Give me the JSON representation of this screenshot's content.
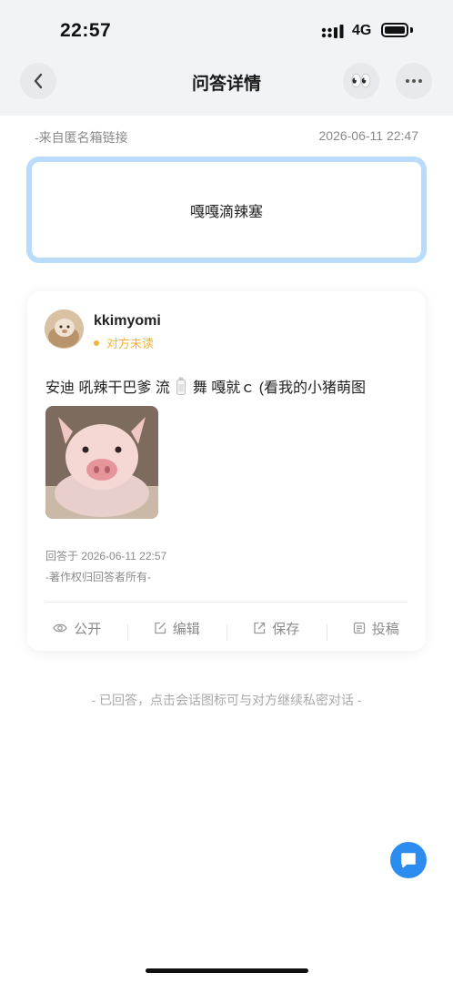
{
  "status_bar": {
    "time": "22:57",
    "network": "4G"
  },
  "header": {
    "title": "问答详情",
    "eyes_emoji": "👀"
  },
  "question": {
    "source": "-来自匿名箱链接",
    "date": "2026-06-11 22:47",
    "text": "嘎嘎滴辣塞"
  },
  "answer": {
    "username": "kkimyomi",
    "read_status": "对方未读",
    "text_before": "安迪 吼辣干巴爹 流",
    "text_after": "舞 嘎就ｃ (看我的小猪萌图",
    "answered_at": "回答于 2026-06-11 22:57",
    "copyright": "-著作权归回答者所有-",
    "actions": [
      {
        "label": "公开",
        "icon": "eye-icon"
      },
      {
        "label": "编辑",
        "icon": "edit-icon"
      },
      {
        "label": "保存",
        "icon": "export-icon"
      },
      {
        "label": "投稿",
        "icon": "submit-icon"
      }
    ]
  },
  "footer_note": "- 已回答，点击会话图标可与对方继续私密对话 -",
  "colors": {
    "accent": "#2d8cf0",
    "question_border": "#b9dcfa",
    "unread": "#f0b23a",
    "muted_text": "#8a8a8a"
  }
}
